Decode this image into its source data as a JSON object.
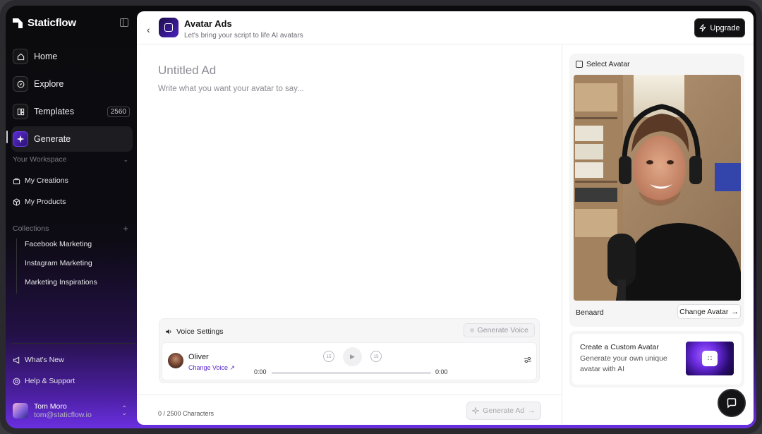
{
  "brand": {
    "name": "Staticflow"
  },
  "sidebar": {
    "nav": [
      {
        "label": "Home",
        "icon": "home-icon"
      },
      {
        "label": "Explore",
        "icon": "compass-icon"
      },
      {
        "label": "Templates",
        "icon": "layout-icon",
        "badge": "2560"
      },
      {
        "label": "Generate",
        "icon": "sparkle-icon",
        "active": true
      }
    ],
    "workspace": {
      "heading": "Your Workspace",
      "items": [
        {
          "label": "My Creations",
          "icon": "stack-icon"
        },
        {
          "label": "My Products",
          "icon": "box-icon"
        }
      ]
    },
    "collections": {
      "heading": "Collections",
      "items": [
        "Facebook Marketing",
        "Instagram Marketing",
        "Marketing Inspirations"
      ]
    },
    "footer": {
      "whats_new": "What's New",
      "help": "Help & Support"
    },
    "user": {
      "name": "Tom Moro",
      "email": "tom@staticflow.io"
    }
  },
  "header": {
    "title": "Avatar Ads",
    "subtitle": "Let's bring your script to life AI avatars",
    "upgrade_label": "Upgrade"
  },
  "editor": {
    "title_placeholder": "Untitled Ad",
    "body_placeholder": "Write what you want your avatar to say...",
    "voice_settings": {
      "heading": "Voice Settings",
      "generate_label": "Generate Voice",
      "voice_name": "Oliver",
      "change_voice_label": "Change Voice ↗",
      "time_start": "0:00",
      "time_end": "0:00",
      "progress": 0,
      "skip_back": "15",
      "skip_forward": "15"
    },
    "char_count": "0 / 2500 Characters",
    "generate_ad_label": "Generate Ad"
  },
  "avatar_panel": {
    "heading": "Select Avatar",
    "avatar_name": "Benaard",
    "change_label": "Change Avatar",
    "custom": {
      "title": "Create a Custom Avatar",
      "description": "Generate your own unique avatar with AI"
    }
  },
  "colors": {
    "accent": "#5a2bd0",
    "sidebar_bg": "#0b0b0d",
    "glow": "#6a2fe0"
  }
}
